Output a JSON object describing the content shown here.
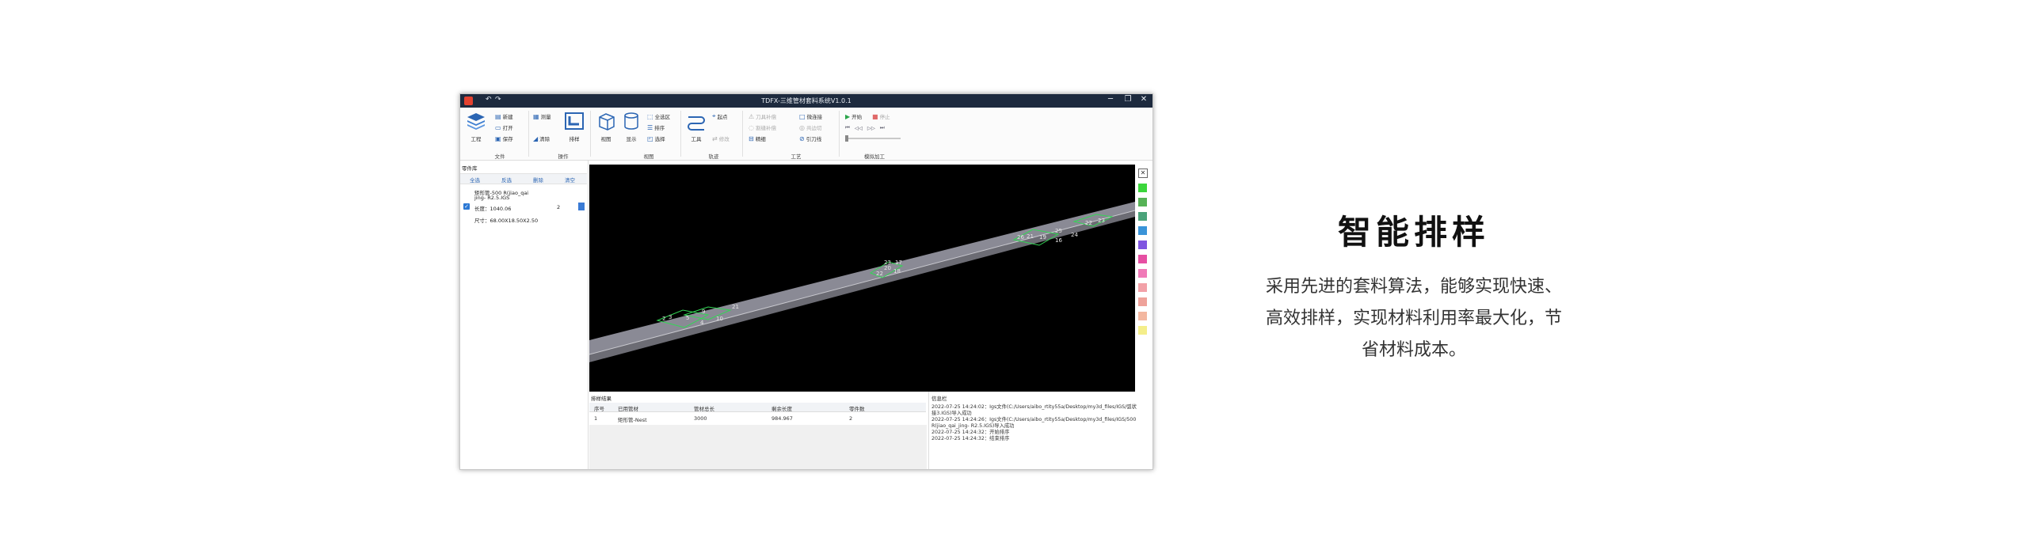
{
  "window": {
    "title": "TDFX-三维管材套料系统V1.0.1",
    "controls": {
      "minimize": "─",
      "maximize": "❐",
      "close": "✕"
    }
  },
  "ribbon": {
    "file": {
      "project": "工程",
      "new": "新建",
      "open": "打开",
      "save_as": "保存",
      "group": "文件"
    },
    "operation": {
      "measure": "测量",
      "clear": "清除",
      "nest": "排样",
      "group": "操作"
    },
    "view": {
      "view": "视图",
      "show": "显示",
      "select_all": "全选区",
      "sort": "排序",
      "selection": "选择",
      "group": "视图"
    },
    "trajectory": {
      "tool": "工具",
      "start_point": "起点",
      "modify": "修改",
      "group": "轨迹"
    },
    "process": {
      "lead_in": "刀具补偿",
      "micro_joint": "微连接",
      "lead_out": "割缝补偿",
      "common_edge": "共边切",
      "fine_cut": "精细",
      "cut_order": "引刀线",
      "group": "工艺"
    },
    "sim": {
      "start": "开始",
      "stop": "停止",
      "group": "模拟加工"
    }
  },
  "left_panel": {
    "header": "零件库",
    "buttons": [
      "全选",
      "反选",
      "删除",
      "清空"
    ],
    "part": {
      "name": "矩形管-500 R(jiao_qai",
      "name2": "jing- R2.5.IGS",
      "length": "长度：1040.06",
      "qty": "2",
      "size": "尺寸：68.00X18.50X2.50"
    }
  },
  "viewport": {
    "labels": [
      "2",
      "3",
      "5",
      "4",
      "9",
      "10",
      "21",
      "22",
      "20",
      "18",
      "23",
      "17",
      "26",
      "21",
      "19",
      "25",
      "24",
      "16",
      "22",
      "23"
    ]
  },
  "colors": [
    "#3cd63c",
    "#56b256",
    "#4aa37a",
    "#3a94d8",
    "#7f55e0",
    "#e64fa3",
    "#f07ab8",
    "#f2a1a8",
    "#eea29a",
    "#f3b7a0",
    "#f4ee8a"
  ],
  "results": {
    "title": "排样结果",
    "headers": [
      "序号",
      "已用管材",
      "管材总长",
      "剩余长度",
      "零件数"
    ],
    "row": [
      "1",
      "矩形管-Nest",
      "3000",
      "984.967",
      "2"
    ]
  },
  "info": {
    "title": "信息栏",
    "lines": [
      "2022-07-25 14:24:02：Igs文件(C:/Users/aibo_rtity55a/Desktop/my3d_files/IGS/弧状",
      "接3.IGS)导入成功",
      "2022-07-25 14:24:26：Igs文件(C:/Users/aibo_rtity55a/Desktop/my3d_files/IGS/500",
      "R(jiao_qai_jing- R2.5.IGS)导入成功",
      "2022-07-25 14:24:32：开始排序",
      "2022-07-25 14:24:32：结束排序"
    ]
  },
  "feature": {
    "title": "智能排样",
    "desc_line1": "采用先进的套料算法，能够实现快速、",
    "desc_line2": "高效排样，实现材料利用率最大化，节",
    "desc_line3": "省材料成本。"
  }
}
